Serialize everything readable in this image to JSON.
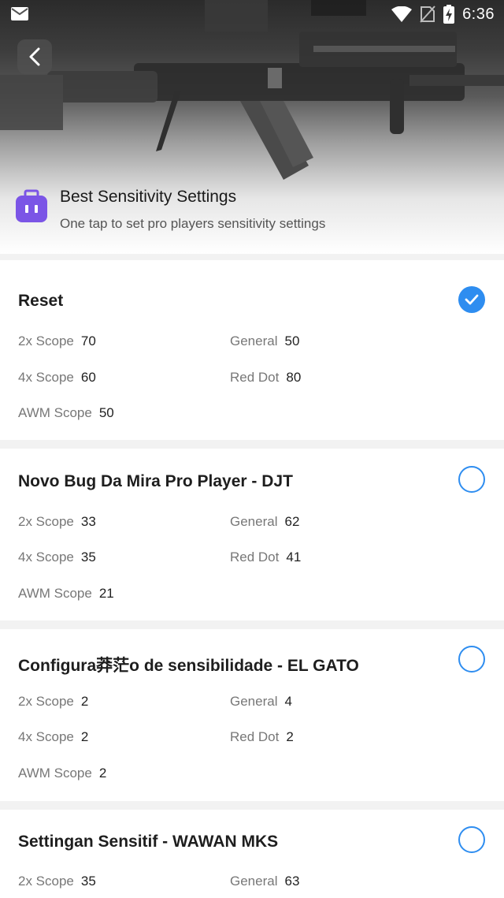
{
  "status_bar": {
    "time": "6:36",
    "icons": [
      "mail-icon",
      "wifi-icon",
      "no-sim-icon",
      "battery-charging-icon"
    ]
  },
  "header": {
    "title": "Best Sensitivity Settings",
    "subtitle": "One tap to set pro players sensitivity settings",
    "back_icon": "chevron-left-icon",
    "app_icon": "briefcase-icon",
    "app_icon_color": "#7b55e6"
  },
  "accent_color": "#2e8df0",
  "presets": [
    {
      "title": "Reset",
      "selected": true,
      "scope2x_label": "2x Scope",
      "scope2x": "70",
      "general_label": "General",
      "general": "50",
      "scope4x_label": "4x Scope",
      "scope4x": "60",
      "reddot_label": "Red Dot",
      "reddot": "80",
      "awm_label": "AWM Scope",
      "awm": "50"
    },
    {
      "title": "Novo Bug Da Mira Pro Player - DJT",
      "selected": false,
      "scope2x_label": "2x Scope",
      "scope2x": "33",
      "general_label": "General",
      "general": "62",
      "scope4x_label": "4x Scope",
      "scope4x": "35",
      "reddot_label": "Red Dot",
      "reddot": "41",
      "awm_label": "AWM Scope",
      "awm": "21"
    },
    {
      "title": "Configura莽茫o de sensibilidade - EL GATO",
      "selected": false,
      "scope2x_label": "2x Scope",
      "scope2x": "2",
      "general_label": "General",
      "general": "4",
      "scope4x_label": "4x Scope",
      "scope4x": "2",
      "reddot_label": "Red Dot",
      "reddot": "2",
      "awm_label": "AWM Scope",
      "awm": "2"
    },
    {
      "title": "Settingan Sensitif - WAWAN MKS",
      "selected": false,
      "scope2x_label": "2x Scope",
      "scope2x": "35",
      "general_label": "General",
      "general": "63"
    }
  ]
}
